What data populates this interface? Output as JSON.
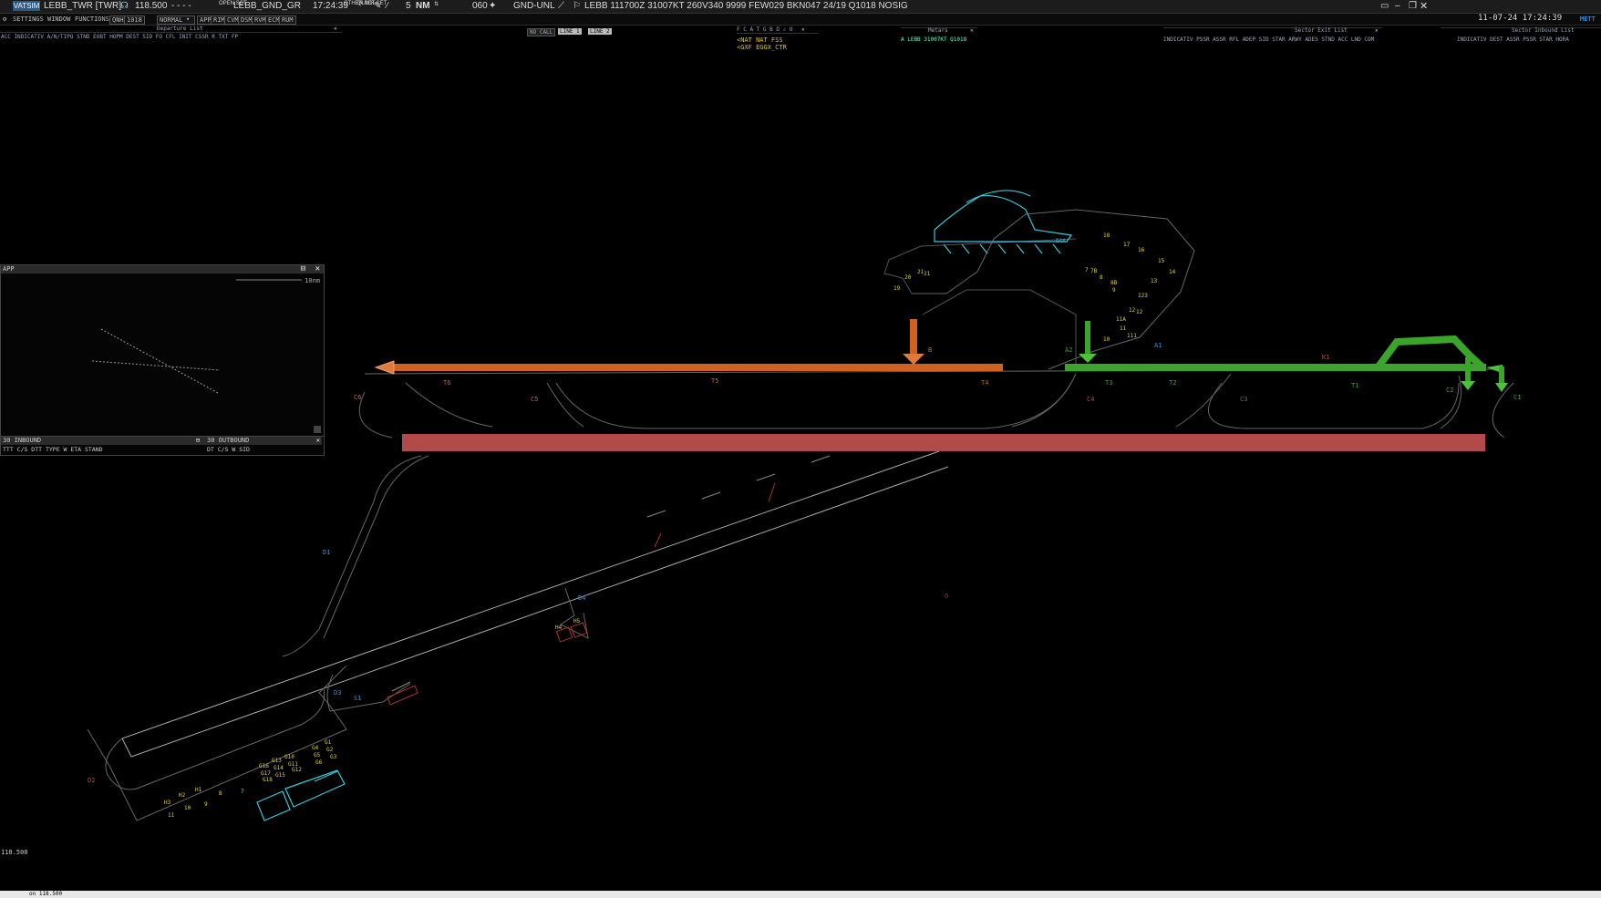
{
  "topbar": {
    "logo": "VATSIM",
    "position": "LEBB_TWR [TWR]",
    "frequency": "118.500",
    "dashes": "- - - -",
    "open_sct_label": "OPEN SCT",
    "sector": "LEBB_GND_GR",
    "time": "17:24:39",
    "other_set": "OTHER SET",
    "quick_set": "QUICK SET",
    "range_value": "5",
    "range_unit": "NM",
    "fl_value": "060",
    "filter": "GND-UNL",
    "metar": "LEBB 111700Z 31007KT 260V340 9999 FEW029 BKN047 24/19 Q1018 NOSIG"
  },
  "menubar": {
    "settings": "SETTINGS",
    "window": "WINDOW",
    "functions": "FUNCTIONS",
    "qnh_label": "QNH",
    "qnh_value": "1018",
    "mode": "NORMAL",
    "btns": [
      "APP",
      "RIM",
      "CVM",
      "DSM",
      "RVM",
      "ECM",
      "RUM"
    ],
    "datetime": "11-07-24 17:24:39",
    "last": "METT"
  },
  "lists": {
    "departure_title": "Departure List",
    "departure_cols": "ACC INDICATIV A/N/TIPO STND EOBT HOPM DEST   SID    FO   CFL  INIT  CSSR R    TXT    FP",
    "call": "NO CALL",
    "line1": "LINE 1",
    "line2": "LINE 2",
    "notes_line1": "<NAT NAT FSS",
    "notes_line2": "<GXF EGGX_CTR",
    "metar_title": "Metars",
    "metar_line": "A LEBB 31007KT Q1018",
    "exit_title": "Sector Exit List",
    "exit_cols": "INDICATIV PSSR  ASSR  RFL  ADEP   SID     STAR  ARWY ADES STND   ACC  LND COM",
    "inbound_title": "Sector Inbound List",
    "inbound_cols": "INDICATIV  DEST  ASSR PSSR   STAR  HORA"
  },
  "app_panel": {
    "title": "APP",
    "scale": "10nm"
  },
  "inout_panel": {
    "inbound_title": "30 INBOUND",
    "outbound_title": "30 OUTBOUND",
    "inbound_cols": "TTT  C/S      DTT TYPE W ETA   STAND",
    "outbound_cols": "DT  C/S      W SID"
  },
  "map_labels": {
    "taxiways_orange": [
      "T6",
      "T5",
      "T4",
      "C6",
      "C5",
      "B"
    ],
    "taxiways_green": [
      "T3",
      "T2",
      "T1",
      "A2",
      "A1",
      "K1",
      "C2",
      "C1"
    ],
    "red_labels": [
      "C4",
      "C3"
    ],
    "blue_labels": [
      "D1",
      "D4",
      "D3",
      "S1"
    ],
    "d2": "D2",
    "stands_north": [
      "18",
      "17",
      "16",
      "15",
      "14",
      "13",
      "123",
      "12",
      "12",
      "11A",
      "11",
      "111",
      "10",
      "7",
      "7B",
      "8",
      "8B",
      "9",
      "21",
      "21",
      "20",
      "19",
      "G4A"
    ],
    "stands_south": [
      "G1",
      "G2",
      "G3",
      "G4",
      "G5",
      "G6",
      "G10",
      "G11",
      "G12",
      "G13",
      "G14",
      "G15",
      "G16",
      "G17",
      "G18",
      "H1",
      "H2",
      "H3",
      "B",
      "7",
      "9",
      "10",
      "11",
      "H4",
      "H5"
    ]
  },
  "status": {
    "freq_readout": "118.500",
    "cmd": "on 118.500"
  },
  "colors": {
    "orange_route": "#d2601e",
    "green_route": "#3aa52a",
    "runway_occupied": "#b24a4a",
    "terminal": "#38c8d8"
  }
}
